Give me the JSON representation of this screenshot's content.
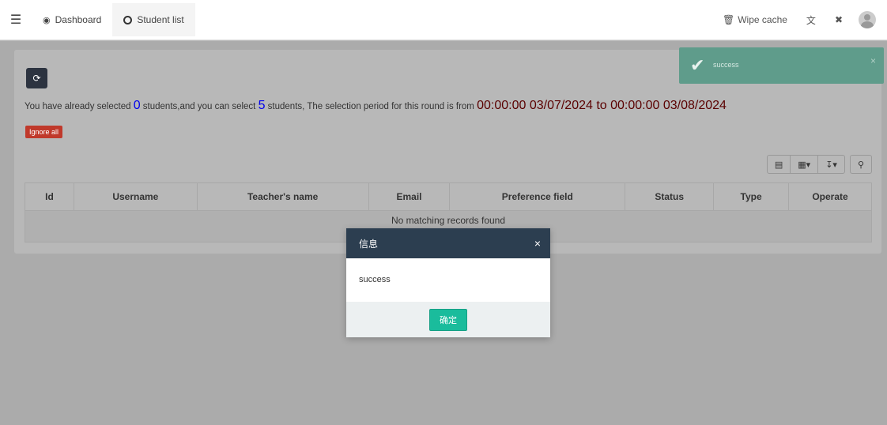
{
  "topbar": {
    "menu_icon": "hamburger-icon",
    "tabs": [
      {
        "label": "Dashboard",
        "icon": "dashboard-icon",
        "active": false
      },
      {
        "label": "Student list",
        "icon": "circle-icon",
        "active": true
      }
    ],
    "wipe_cache_label": "Wipe cache",
    "translate_icon": "translate-icon",
    "fullscreen_icon": "fullscreen-icon"
  },
  "panel": {
    "refresh_icon": "refresh-icon",
    "info": {
      "part1": "You have already selected ",
      "selected_count": "0",
      "part2": " students,and you can select ",
      "max_count": "5",
      "part3": " students, The selection period for this round is from ",
      "period": "00:00:00 03/07/2024 to 00:00:00 03/08/2024"
    },
    "ignore_all_label": "Ignore all"
  },
  "table": {
    "columns": [
      "Id",
      "Username",
      "Teacher's name",
      "Email",
      "Preference field",
      "Status",
      "Type",
      "Operate"
    ],
    "empty_message": "No matching records found"
  },
  "toast": {
    "message": "success",
    "close": "×"
  },
  "modal": {
    "title": "信息",
    "close": "×",
    "body": "success",
    "ok_label": "确定"
  },
  "colors": {
    "dark": "#2c3e50",
    "ok": "#1abc9c",
    "danger": "#c0392b",
    "toast": "#5f9c8b",
    "period": "#5a0000",
    "count": "#0000ee"
  }
}
